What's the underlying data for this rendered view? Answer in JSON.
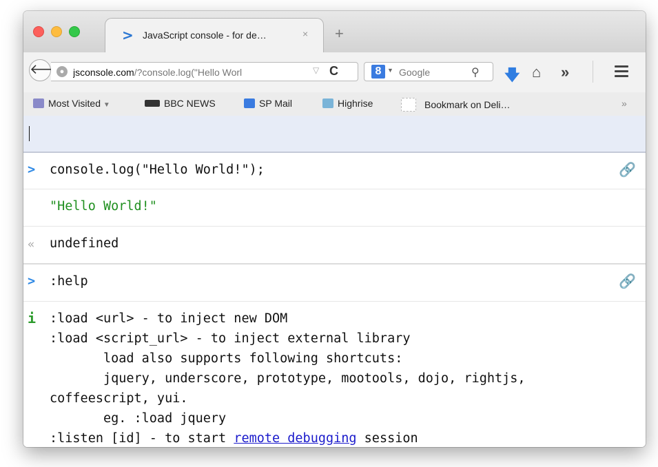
{
  "window": {
    "tab_title": "JavaScript console - for de…",
    "tab_close": "×",
    "new_tab": "+",
    "tab_favicon": ">"
  },
  "navbar": {
    "url_host": "jsconsole.com",
    "url_rest": "/?console.log(\"Hello Worl",
    "search_engine": "8",
    "search_placeholder": "Google",
    "icons": [
      "back-icon",
      "site-info-icon",
      "reload-icon",
      "search-engine-icon",
      "search-icon",
      "download-icon",
      "home-icon",
      "overflow-chevron-icon",
      "hamburger-menu-icon"
    ]
  },
  "bookmarks": {
    "items": [
      {
        "label": "Most Visited",
        "icon": "folder-icon",
        "has_dropdown": true
      },
      {
        "label": "BBC NEWS",
        "icon": "bbc-icon"
      },
      {
        "label": "SP Mail",
        "icon": "sp-mail-icon"
      },
      {
        "label": "Highrise",
        "icon": "highrise-icon"
      },
      {
        "label": "Bookmark on Deli…",
        "icon": "delicious-icon"
      }
    ],
    "overflow": "»"
  },
  "console": {
    "input_value": "",
    "entries": [
      {
        "type": "input",
        "marker": ">",
        "text": "console.log(\"Hello World!\");"
      },
      {
        "type": "log",
        "marker": "",
        "text": "\"Hello World!\""
      },
      {
        "type": "result",
        "marker": "«",
        "text": "undefined"
      },
      {
        "type": "input",
        "marker": ">",
        "text": ":help"
      },
      {
        "type": "info",
        "marker": "i",
        "lines": [
          ":load <url> - to inject new DOM",
          ":load <script_url> - to inject external library",
          "       load also supports following shortcuts:",
          "       jquery, underscore, prototype, mootools, dojo, rightjs,",
          "coffeescript, yui.",
          "       eg. :load jquery"
        ],
        "listen_prefix": ":listen [id] - to start ",
        "listen_link": "remote debugging",
        "listen_suffix": " session"
      }
    ]
  },
  "colors": {
    "prompt": "#2f89e5",
    "string": "#1f8f1f",
    "info": "#2c9b2c",
    "link": "#1a1acb",
    "input_bg": "#e7ecf7"
  }
}
